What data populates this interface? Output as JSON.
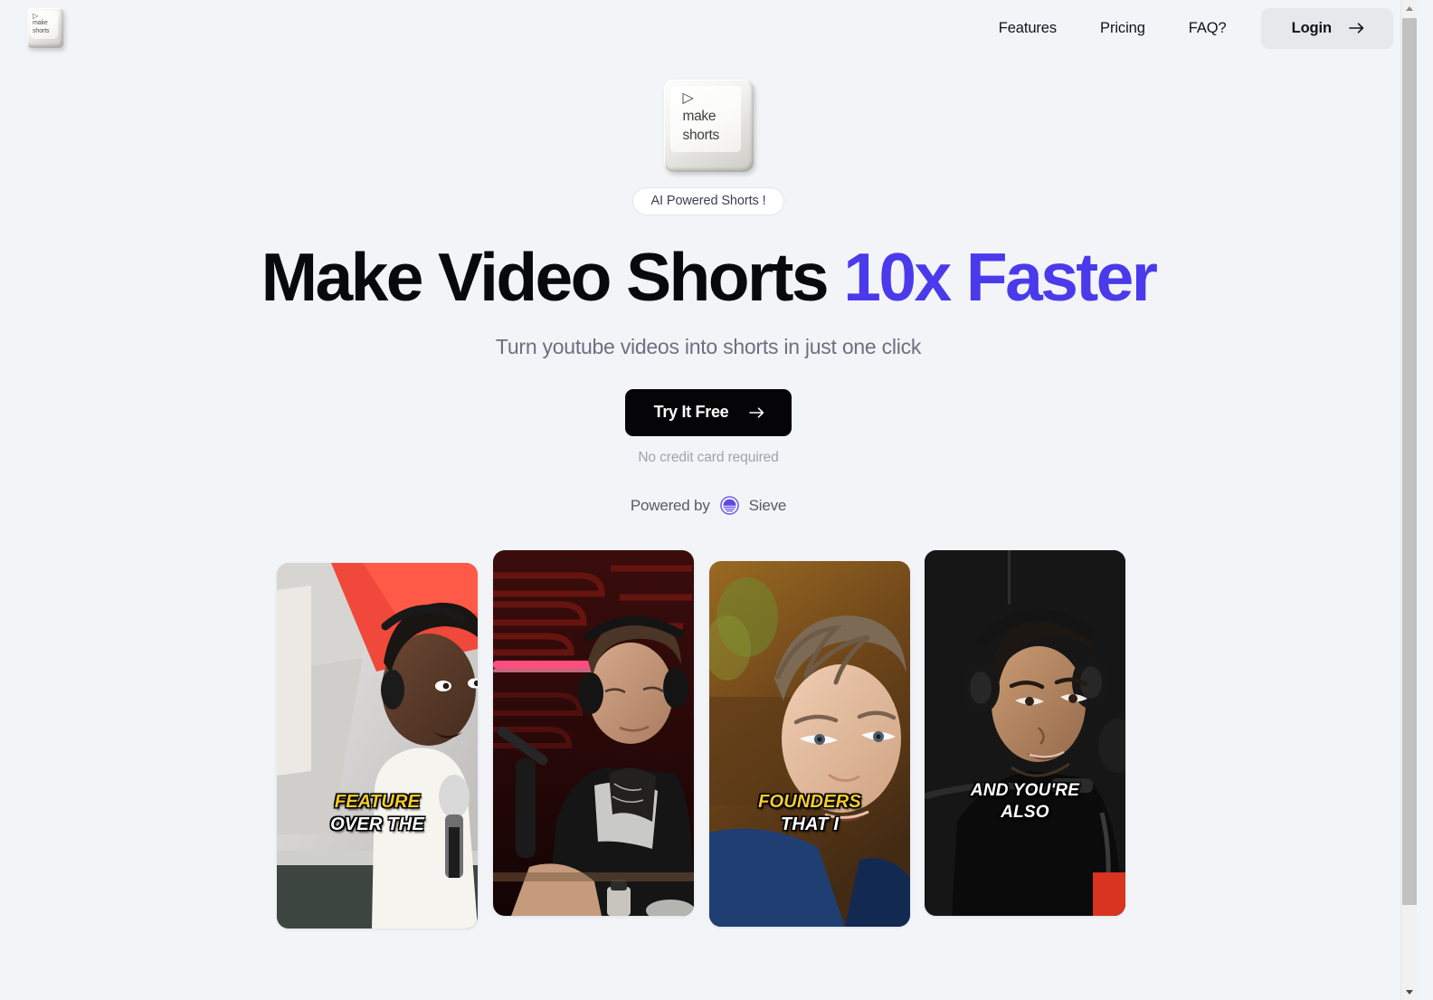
{
  "brand": {
    "name": "make shorts",
    "logo_play_icon": "play-triangle-icon",
    "logo_line1": "make",
    "logo_line2": "shorts"
  },
  "header": {
    "nav": [
      {
        "label": "Features",
        "name": "nav-features"
      },
      {
        "label": "Pricing",
        "name": "nav-pricing"
      },
      {
        "label": "FAQ?",
        "name": "nav-faq"
      }
    ],
    "login": {
      "label": "Login",
      "icon": "arrow-right-icon"
    }
  },
  "hero": {
    "badge": "AI Powered Shorts !",
    "headline_main": "Make Video Shorts ",
    "headline_accent": "10x Faster",
    "subheadline": "Turn youtube videos into shorts in just one click",
    "cta": {
      "label": "Try It Free",
      "icon": "arrow-right-icon"
    },
    "no_credit_card": "No credit card required",
    "powered_by_prefix": "Powered by",
    "powered_by_brand": "Sieve",
    "powered_by_icon": "sieve-logo-icon"
  },
  "colors": {
    "background": "#f2f4f8",
    "accent": "#4a3aeb",
    "cta_background": "#050507",
    "login_background": "#e7e8ec",
    "caption_highlight": "#f5cc2a",
    "sieve_purple": "#6c5ce7"
  },
  "cards": [
    {
      "name": "short-card-1",
      "alt": "Man with headphones at microphone in studio",
      "caption_line1": "FEATURE",
      "caption_line2": "OVER THE",
      "caption_style": "yellow-white"
    },
    {
      "name": "short-card-2",
      "alt": "Man with headphones at podcast microphone, dark red studio",
      "caption_line1": "",
      "caption_line2": "",
      "caption_style": "none"
    },
    {
      "name": "short-card-3",
      "alt": "Man looking down in warm lit room",
      "caption_line1": "FOUNDERS",
      "caption_line2": "THAT I",
      "caption_style": "yellow-white"
    },
    {
      "name": "short-card-4",
      "alt": "Man with headphones in dark podcast studio",
      "caption_line1": "AND YOU'RE",
      "caption_line2": "ALSO",
      "caption_style": "white-white"
    }
  ],
  "scrollbar": {
    "up_icon": "triangle-up-icon",
    "down_icon": "triangle-down-icon"
  }
}
